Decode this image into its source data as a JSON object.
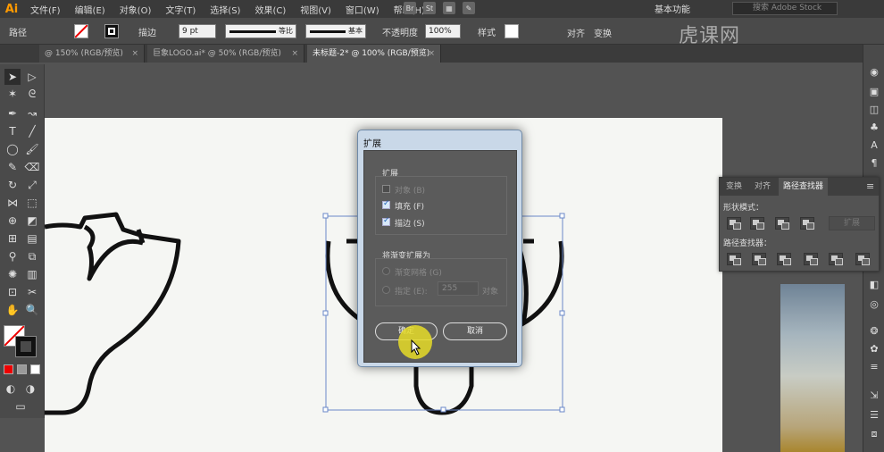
{
  "app": {
    "logo": "Ai",
    "brand_color": "#ff9a00"
  },
  "menu": [
    "文件(F)",
    "编辑(E)",
    "对象(O)",
    "文字(T)",
    "选择(S)",
    "效果(C)",
    "视图(V)",
    "窗口(W)",
    "帮助(H)"
  ],
  "menu_icons": [
    "Br",
    "St"
  ],
  "workspace": "基本功能",
  "search_placeholder": "搜索 Adobe Stock",
  "watermark": "虎课网",
  "control": {
    "selection_type": "路径",
    "stroke_label": "描边",
    "stroke_weight": "9 pt",
    "profile_label": "等比",
    "brush_label": "基本",
    "opacity_label": "不透明度",
    "opacity_value": "100%",
    "style_label": "样式",
    "align_label": "对齐",
    "transform_label": "变换"
  },
  "tabs": [
    {
      "label": "@ 150% (RGB/预览)",
      "active": false
    },
    {
      "label": "巨象LOGO.ai* @ 50% (RGB/预览)",
      "active": false
    },
    {
      "label": "未标题-2* @ 100% (RGB/预览)",
      "active": true
    }
  ],
  "pathfinder": {
    "tabs": [
      "变换",
      "对齐",
      "路径查找器"
    ],
    "shape_modes_label": "形状模式：",
    "pathfinders_label": "路径查找器：",
    "expand_label": "扩展"
  },
  "dialog": {
    "title": "扩展",
    "expand_group_label": "扩展",
    "object_label": "对象 (B)",
    "fill_label": "填充 (F)",
    "stroke_label": "描边 (S)",
    "object_checked": false,
    "fill_checked": true,
    "stroke_checked": true,
    "gradient_group_label": "将渐变扩展为",
    "gradient_mesh_label": "渐变网格 (G)",
    "specify_label": "指定 (E):",
    "specify_value": "255",
    "objects_label": "对象",
    "ok_label": "确定",
    "cancel_label": "取消"
  }
}
